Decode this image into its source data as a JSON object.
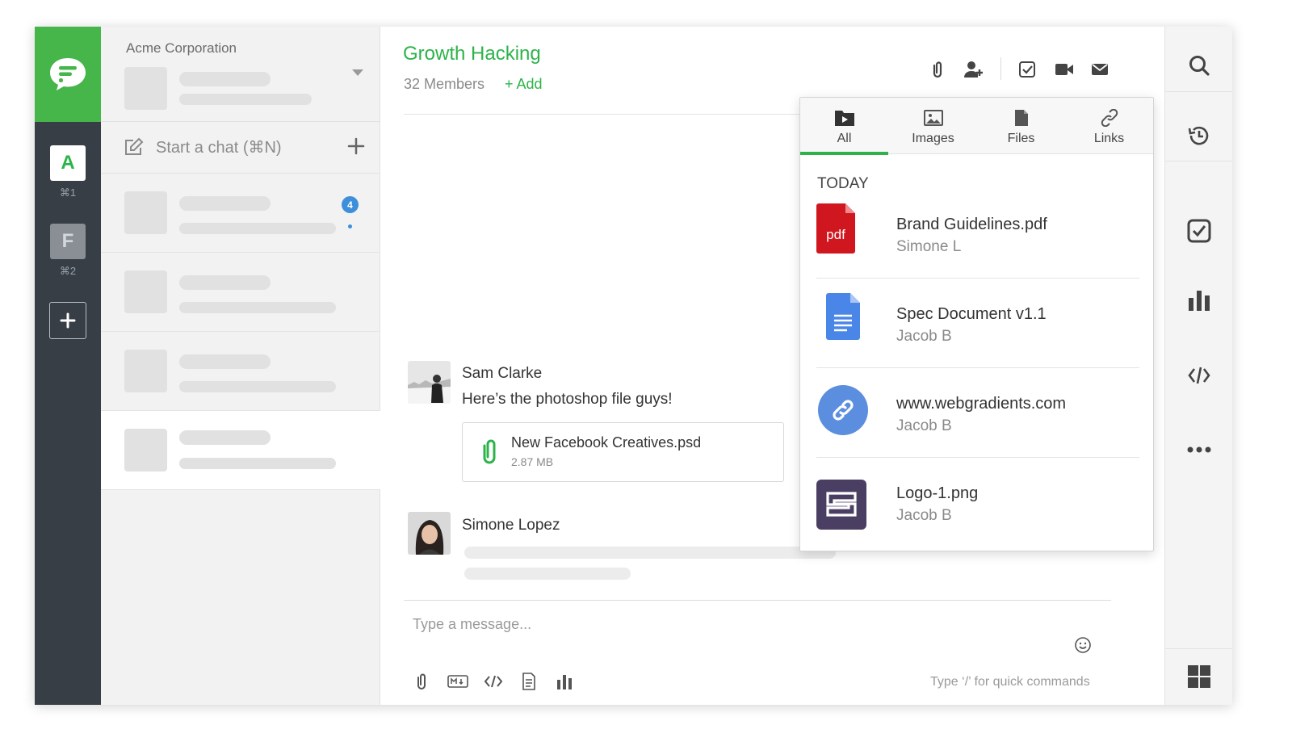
{
  "workspace": {
    "org_name": "Acme Corporation",
    "items": [
      {
        "letter": "A",
        "shortcut": "⌘1"
      },
      {
        "letter": "F",
        "shortcut": "⌘2"
      }
    ]
  },
  "chat_list": {
    "start_chat_label": "Start a chat (⌘N)",
    "unread_count": "4"
  },
  "channel": {
    "title": "Growth Hacking",
    "members": "32 Members",
    "add_label": "+ Add"
  },
  "messages": [
    {
      "author": "Sam Clarke",
      "text": "Here’s the photoshop file guys!",
      "attachment": {
        "name": "New Facebook Creatives.psd",
        "size": "2.87 MB"
      }
    },
    {
      "author": "Simone Lopez"
    }
  ],
  "composer": {
    "placeholder": "Type a message...",
    "hint": "Type ‘/’ for quick commands"
  },
  "media_panel": {
    "tabs": [
      {
        "label": "All",
        "icon": "folder-video-icon",
        "active": true
      },
      {
        "label": "Images",
        "icon": "image-icon",
        "active": false
      },
      {
        "label": "Files",
        "icon": "file-icon",
        "active": false
      },
      {
        "label": "Links",
        "icon": "link-icon",
        "active": false
      }
    ],
    "section": "TODAY",
    "items": [
      {
        "name": "Brand Guidelines.pdf",
        "owner": "Simone L",
        "icon": "pdf-file-icon",
        "icon_text": "pdf"
      },
      {
        "name": "Spec Document v1.1",
        "owner": "Jacob B",
        "icon": "google-doc-icon"
      },
      {
        "name": "www.webgradients.com",
        "owner": "Jacob B",
        "icon": "link-icon"
      },
      {
        "name": "Logo-1.png",
        "owner": "Jacob B",
        "icon": "image-file-icon"
      }
    ]
  },
  "colors": {
    "brand_green": "#46b54a",
    "accent_green": "#2db34a",
    "rail_dark": "#373e46",
    "badge_blue": "#3d8fdc",
    "pdf_red": "#d0161f",
    "doc_blue": "#4a86e8",
    "link_blue": "#5b8ede",
    "logo_purple": "#4a3f63"
  }
}
